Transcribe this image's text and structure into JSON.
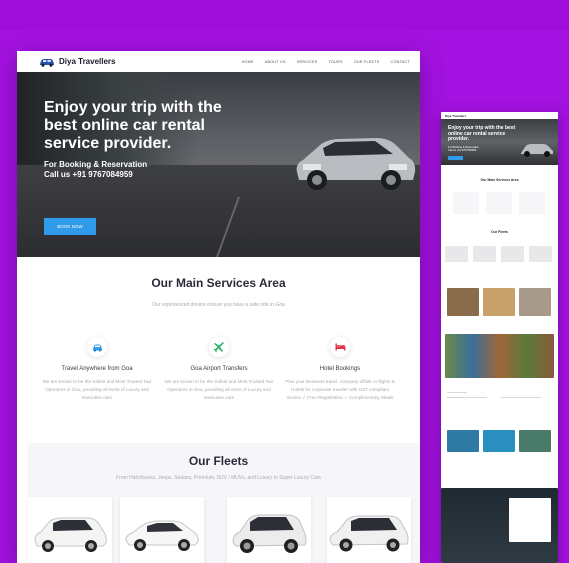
{
  "nav": {
    "brand": "Diya Travellers",
    "menu": [
      "HOME",
      "ABOUT US",
      "SERVICES",
      "TOURS",
      "OUR FLEETS",
      "CONTACT"
    ]
  },
  "hero": {
    "headline": "Enjoy your trip with the best online car rental service provider.",
    "booking_line": "For Booking & Reservation",
    "phone_line": "Call us +91 9767084959",
    "cta": "BOOK NOW"
  },
  "services": {
    "title": "Our Main Services Area",
    "subtitle": "Our experienced drivers ensure you have a safe ride in Goa",
    "items": [
      {
        "icon": "car-icon",
        "name": "Travel Anywhere from Goa",
        "desc": "We are known to be the Safest and Most Trusted Taxi Operators in Goa, providing all Sorts of Luxury and Executive cars"
      },
      {
        "icon": "airplane-icon",
        "name": "Goa Airport Transfers",
        "desc": "We are known to be the Safest and Most Trusted Taxi Operators in Goa, providing all Sorts of Luxury and Executive cars"
      },
      {
        "icon": "bed-icon",
        "name": "Hotel Bookings",
        "desc": "Plan your Business travel, company offsite or flights & Hotels for corporate traveler with GST compliant invoice ✓ Free Registration ✓ Complimentary Meals"
      }
    ]
  },
  "fleets": {
    "title": "Our Fleets",
    "subtitle": "From Hatchbacks, Jeeps, Sedans, Premium, SUV / MUVs, and Luxury to Super Luxury Cars"
  },
  "colors": {
    "background": "#a312e0",
    "accent": "#2f9bea",
    "icon_red": "#e0344a",
    "icon_green": "#2fb36b"
  }
}
